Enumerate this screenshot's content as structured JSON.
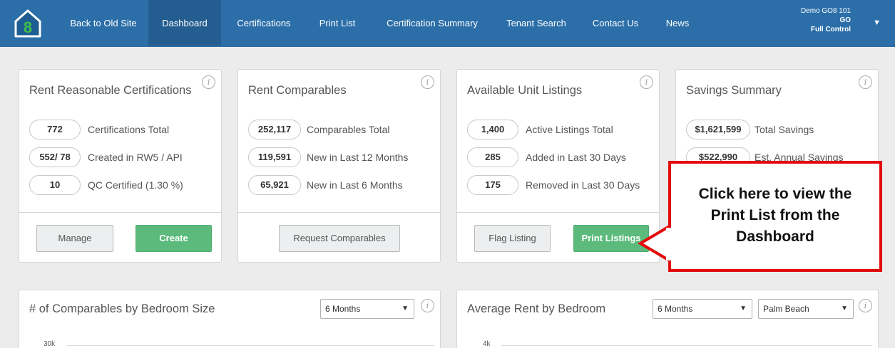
{
  "nav": {
    "items": [
      {
        "label": "Back to Old Site"
      },
      {
        "label": "Dashboard"
      },
      {
        "label": "Certifications"
      },
      {
        "label": "Print List"
      },
      {
        "label": "Certification Summary"
      },
      {
        "label": "Tenant Search"
      },
      {
        "label": "Contact Us"
      },
      {
        "label": "News"
      }
    ],
    "active": "Dashboard",
    "user": {
      "line1": "Demo GO8 101",
      "line2": "GO",
      "line3": "Full Control"
    },
    "caret": "▼",
    "brand_color": "#2b6ea8"
  },
  "cards": [
    {
      "title": "Rent Reasonable Certifications",
      "stats": [
        {
          "value": "772",
          "label": "Certifications Total"
        },
        {
          "value": "552/ 78",
          "label": "Created in RW5 / API"
        },
        {
          "value": "10",
          "label": "QC Certified (1.30 %)"
        }
      ],
      "buttons": [
        {
          "label": "Manage",
          "style": "gray"
        },
        {
          "label": "Create",
          "style": "green"
        }
      ]
    },
    {
      "title": "Rent Comparables",
      "stats": [
        {
          "value": "252,117",
          "label": "Comparables Total"
        },
        {
          "value": "119,591",
          "label": "New in Last 12 Months"
        },
        {
          "value": "65,921",
          "label": "New in Last 6 Months"
        }
      ],
      "buttons": [
        {
          "label": "Request Comparables",
          "style": "gray"
        }
      ]
    },
    {
      "title": "Available Unit Listings",
      "stats": [
        {
          "value": "1,400",
          "label": "Active Listings Total"
        },
        {
          "value": "285",
          "label": "Added in Last 30 Days"
        },
        {
          "value": "175",
          "label": "Removed in Last 30 Days"
        }
      ],
      "buttons": [
        {
          "label": "Flag Listing",
          "style": "gray"
        },
        {
          "label": "Print Listings",
          "style": "green"
        }
      ]
    },
    {
      "title": "Savings Summary",
      "stats": [
        {
          "value": "$1,621,599",
          "label": "Total Savings"
        },
        {
          "value": "$522,990",
          "label": "Est. Annual Savings"
        }
      ],
      "buttons": []
    }
  ],
  "charts": [
    {
      "title": "# of Comparables by Bedroom Size",
      "period": "6 Months",
      "top_tick": "30k"
    },
    {
      "title": "Average Rent by Bedroom",
      "period": "6 Months",
      "region": "Palm Beach",
      "top_tick": "4k"
    }
  ],
  "info_glyph": "i",
  "callout": {
    "text": "Click here to view the Print List from the Dashboard",
    "border_color": "#e20a0a"
  },
  "accent_green": "#5cbb7c"
}
